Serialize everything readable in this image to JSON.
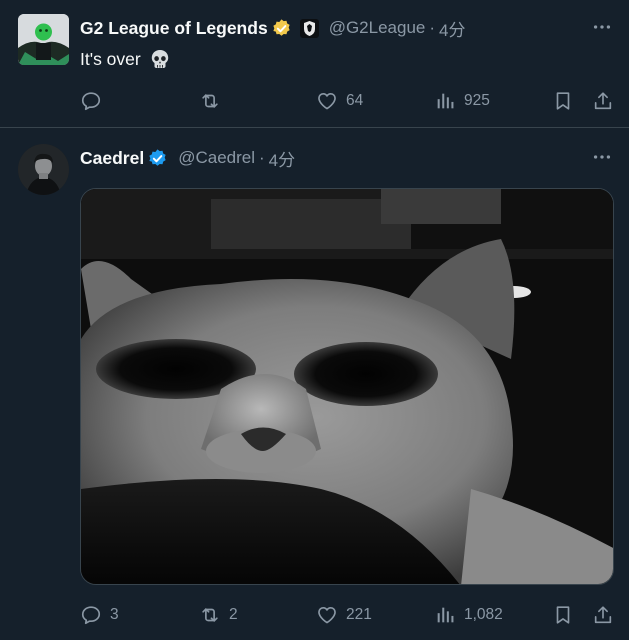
{
  "tweets": [
    {
      "name": "G2 League of Legends",
      "handle": "@G2League",
      "separator": "·",
      "time": "4分",
      "text": "It's over",
      "emoji": "skull-emoji",
      "badge_color": "#f2c94c",
      "avatar": "g2-avatar",
      "affiliation_icon": "g2-esports-logo",
      "counts": {
        "reply": "",
        "retweet": "",
        "like": "64",
        "views": "925"
      }
    },
    {
      "name": "Caedrel",
      "handle": "@Caedrel",
      "separator": "·",
      "time": "4分",
      "text": "",
      "badge_color": "#1d9bf0",
      "avatar": "caedrel-avatar",
      "media": "grayscale-cat-photo",
      "counts": {
        "reply": "3",
        "retweet": "2",
        "like": "221",
        "views": "1,082"
      }
    }
  ],
  "icons": {
    "more": "more-icon",
    "reply": "reply-icon",
    "retweet": "retweet-icon",
    "like": "heart-icon",
    "views": "views-icon",
    "bookmark": "bookmark-icon",
    "share": "share-icon"
  },
  "colors": {
    "background": "#15202b",
    "text": "#f7f9f9",
    "secondary": "#8b98a5",
    "border": "#38444d"
  }
}
